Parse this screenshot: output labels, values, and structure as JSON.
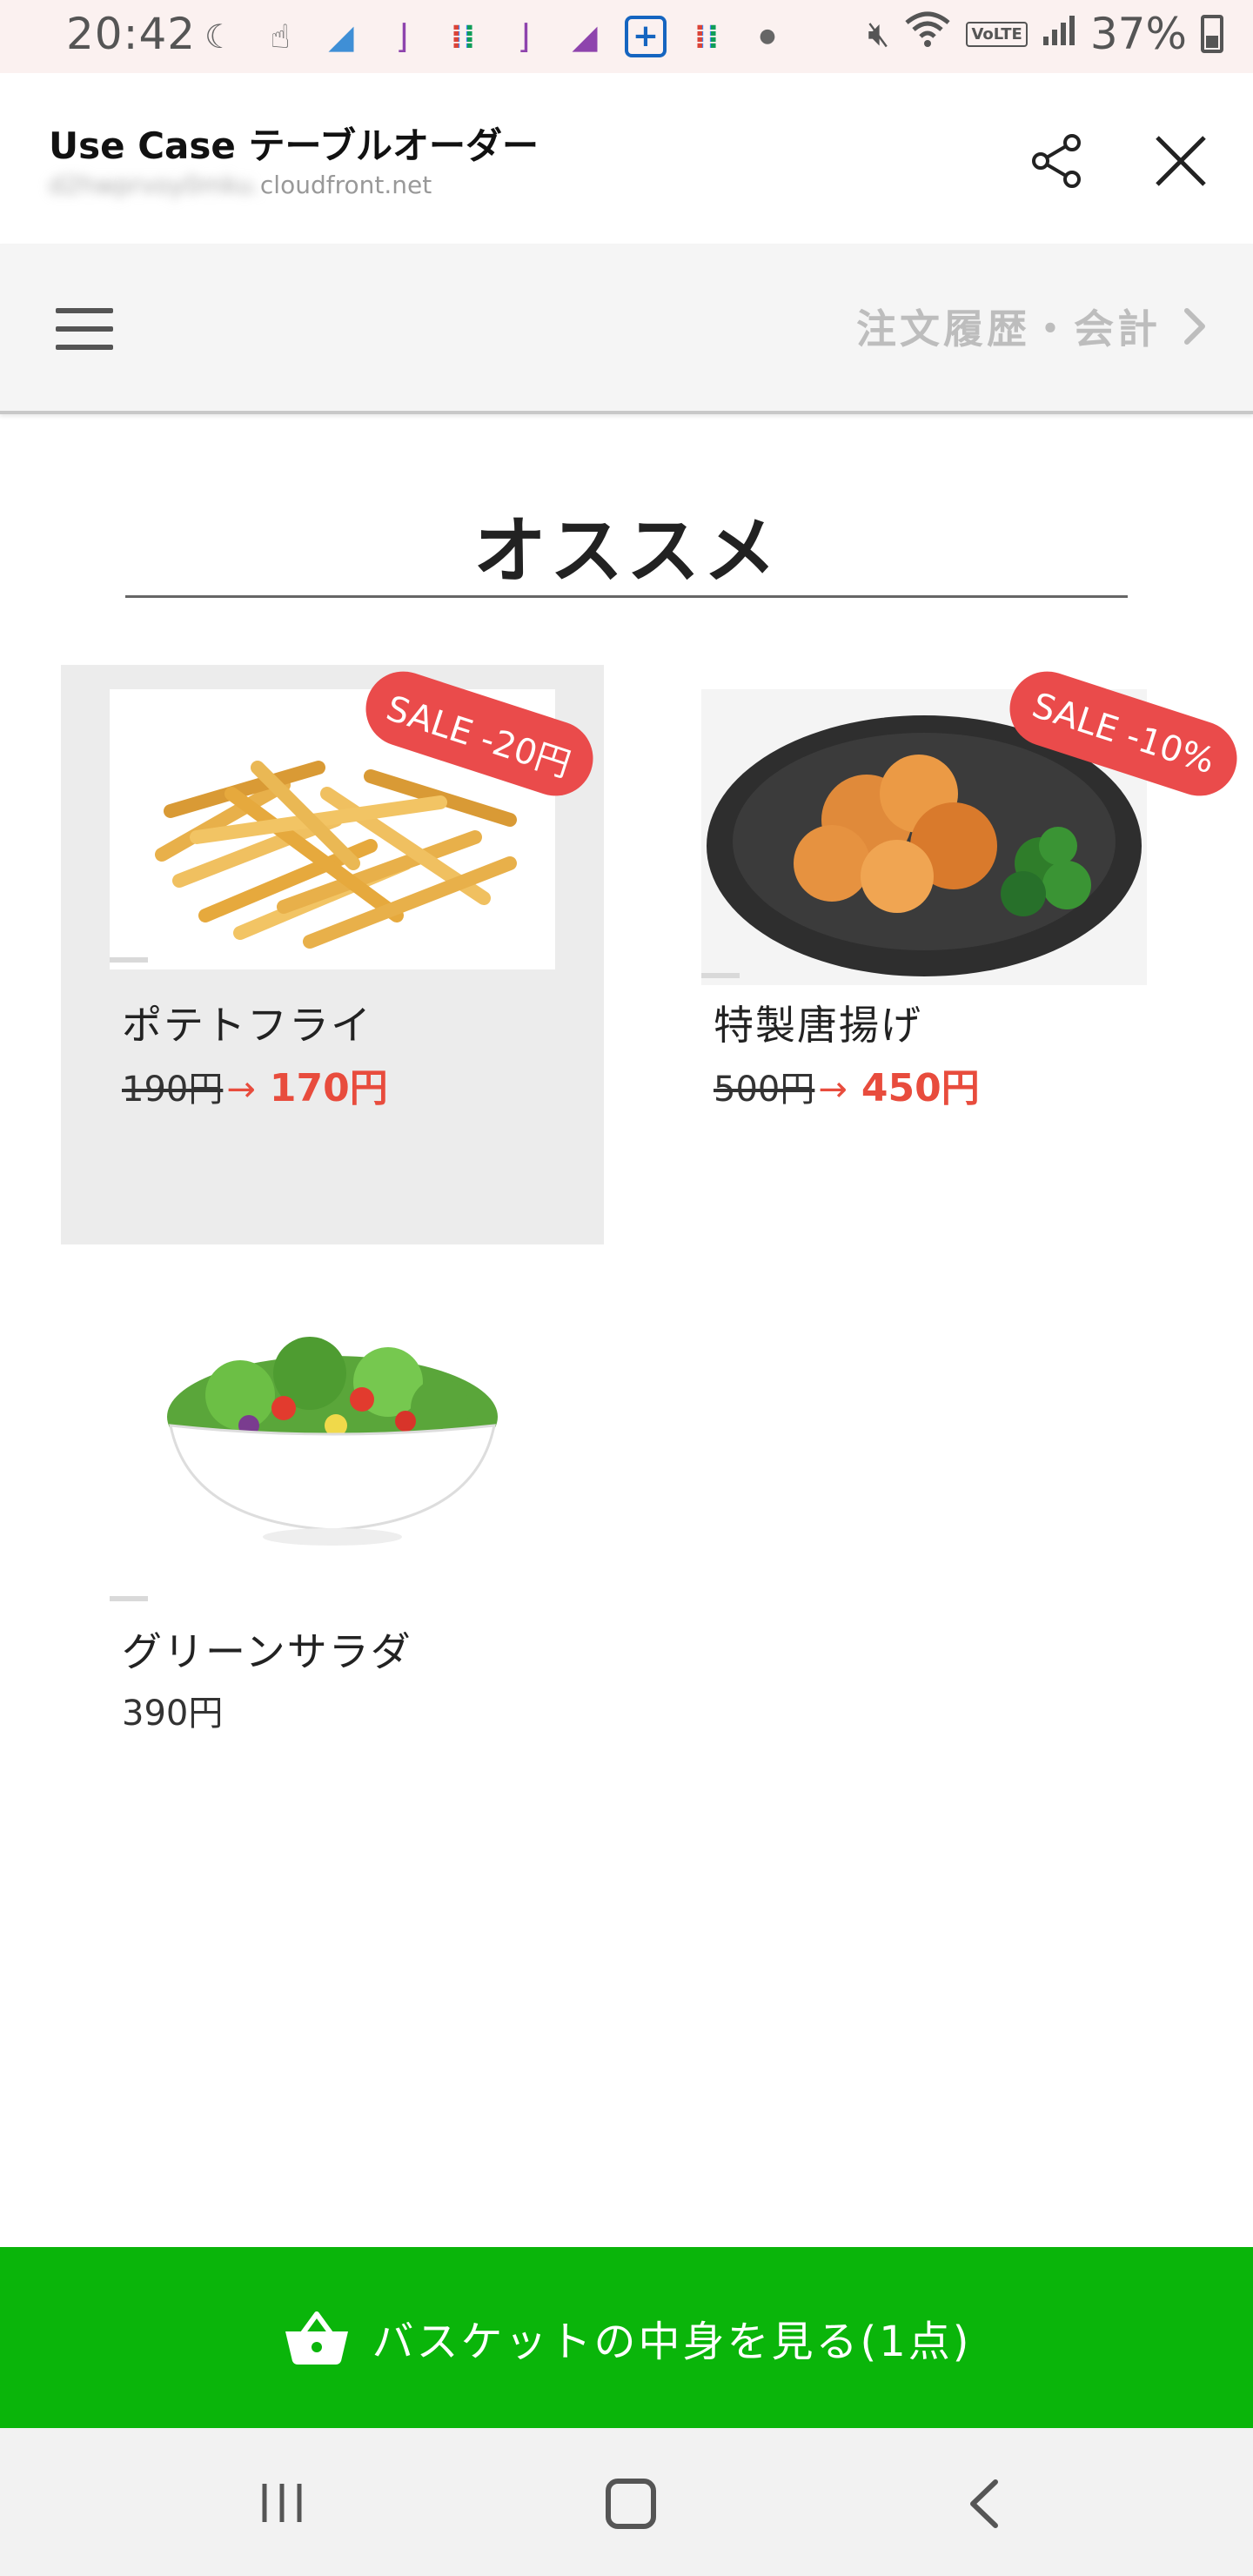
{
  "status_bar": {
    "time": "20:42",
    "battery": "37%",
    "notification_icons": [
      "sleep-moon-icon",
      "touch-hand-icon",
      "prism-icon",
      "bracket-icon",
      "slack-icon",
      "bracket-icon",
      "bracket-icon",
      "plus-box-icon",
      "slack-icon",
      "dot-icon"
    ],
    "network": "VoLTE"
  },
  "browser": {
    "title": "Use Case テーブルオーダー",
    "url_host_suffix": "cloudfront.net",
    "url_blurred": "d2hwprvoy0mku."
  },
  "nav": {
    "history_label": "注文履歴・会計"
  },
  "section": {
    "title": "オススメ"
  },
  "products": [
    {
      "name": "ポテトフライ",
      "old_price": "190円",
      "arrow": "→",
      "new_price": "170円",
      "badge": "SALE -20円",
      "selected": true
    },
    {
      "name": "特製唐揚げ",
      "old_price": "500円",
      "arrow": "→",
      "new_price": "450円",
      "badge": "SALE -10%",
      "selected": false
    },
    {
      "name": "グリーンサラダ",
      "price": "390円",
      "selected": false
    }
  ],
  "basket": {
    "label": "バスケットの中身を見る(1点)"
  },
  "colors": {
    "accent_green": "#0ab50a",
    "sale_red": "#ea4b4b",
    "price_red": "#e84c3d",
    "status_bar_bg": "#fbf1f0"
  }
}
